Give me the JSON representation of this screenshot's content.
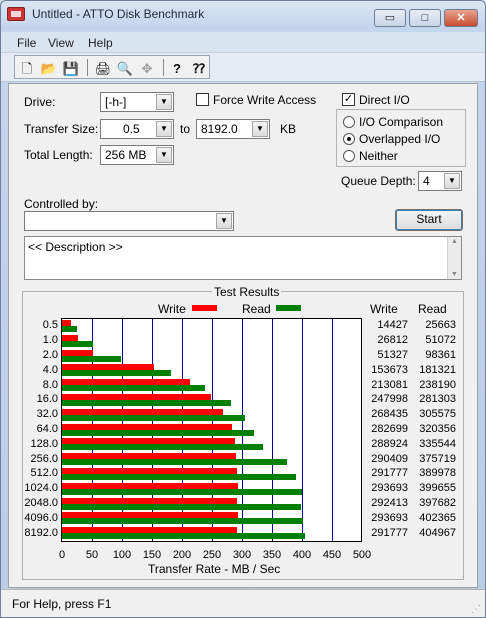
{
  "window": {
    "title": "Untitled - ATTO Disk Benchmark",
    "minimize": "▭",
    "maximize": "□",
    "close": "✕"
  },
  "menu": {
    "items": [
      "File",
      "View",
      "Help"
    ]
  },
  "toolbar": {
    "icons": [
      "new-document-icon",
      "open-folder-icon",
      "save-icon",
      "print-icon",
      "print-preview-icon",
      "move-icon",
      "help-icon",
      "context-help-icon"
    ],
    "glyphs": [
      "🗋",
      "📂",
      "💾",
      "🖨",
      "🔍",
      "✥",
      "?",
      "⁇"
    ]
  },
  "form": {
    "drive_label": "Drive:",
    "drive_value": "[-h-]",
    "force_write_label": "Force Write Access",
    "force_write_checked": false,
    "direct_io_label": "Direct I/O",
    "direct_io_checked": true,
    "transfer_size_label": "Transfer Size:",
    "transfer_from": "0.5",
    "to_label": "to",
    "transfer_to": "8192.0",
    "kb_label": "KB",
    "total_length_label": "Total Length:",
    "total_length_value": "256 MB",
    "io_options": [
      {
        "label": "I/O Comparison",
        "selected": false
      },
      {
        "label": "Overlapped I/O",
        "selected": true
      },
      {
        "label": "Neither",
        "selected": false
      }
    ],
    "queue_depth_label": "Queue Depth:",
    "queue_depth_value": "4",
    "controlled_by_label": "Controlled by:",
    "controlled_by_value": "",
    "start_label": "Start",
    "description_text": "<< Description >>"
  },
  "results": {
    "group_title": "Test Results",
    "write_col": "Write",
    "read_col": "Read"
  },
  "chart_data": {
    "type": "bar",
    "title": "Test Results",
    "xlabel": "Transfer Rate - MB / Sec",
    "xlim": [
      0,
      500
    ],
    "xticks": [
      "0",
      "50",
      "100",
      "150",
      "200",
      "250",
      "300",
      "350",
      "400",
      "450",
      "500"
    ],
    "categories": [
      "0.5",
      "1.0",
      "2.0",
      "4.0",
      "8.0",
      "16.0",
      "32.0",
      "64.0",
      "128.0",
      "256.0",
      "512.0",
      "1024.0",
      "2048.0",
      "4096.0",
      "8192.0"
    ],
    "series": [
      {
        "name": "Write",
        "color": "#ff0000",
        "values": [
          14427,
          26812,
          51327,
          153673,
          213081,
          247998,
          268435,
          282699,
          288924,
          290409,
          291777,
          293693,
          292413,
          293693,
          291777
        ],
        "labels": [
          "14427",
          "26812",
          "51327",
          "153673",
          "213081",
          "247998",
          "268435",
          "282699",
          "288924",
          "290409",
          "291777",
          "293693",
          "292413",
          "293693",
          "291777"
        ]
      },
      {
        "name": "Read",
        "color": "#008000",
        "values": [
          25663,
          51072,
          98361,
          181321,
          238190,
          281303,
          305575,
          320356,
          335544,
          375719,
          389978,
          399655,
          397682,
          402365,
          404967
        ],
        "labels": [
          "25663",
          "51072",
          "98361",
          "181321",
          "238190",
          "281303",
          "305575",
          "320356",
          "335544",
          "375719",
          "389978",
          "399655",
          "397682",
          "402365",
          "404967"
        ]
      }
    ],
    "grid": true,
    "gridline_color": "#0000a0"
  },
  "status": {
    "text": "For Help, press F1"
  }
}
